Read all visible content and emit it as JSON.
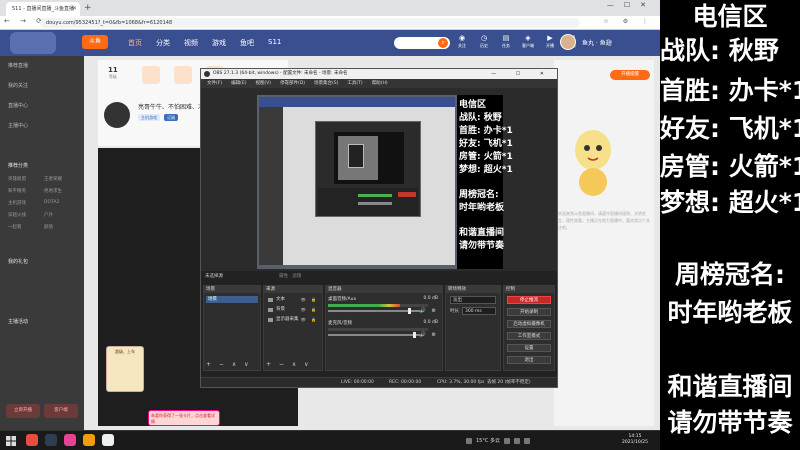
{
  "browser": {
    "tab_title": "511 - 直播间直播_斗鱼直播",
    "url": "douyu.com/9532451?_t=0&fb=1068&fr=6120148",
    "nav_buttons": "← → ⟳",
    "icons": "☆ ⚙ ⋮"
  },
  "site": {
    "logo": "斗鱼",
    "nav": [
      "首页",
      "分类",
      "视频",
      "游戏",
      "鱼吧",
      "S11"
    ],
    "search_icon": "search-icon",
    "header_icons": [
      {
        "glyph": "◉",
        "label": "关注"
      },
      {
        "glyph": "◷",
        "label": "历史"
      },
      {
        "glyph": "▤",
        "label": "任务"
      },
      {
        "glyph": "◈",
        "label": "客户端"
      },
      {
        "glyph": "▶",
        "label": "开播"
      },
      {
        "glyph": "✉",
        "label": "消息"
      }
    ],
    "header_right": "鱼丸 · 鱼翅"
  },
  "sidebar": {
    "items": [
      "推荐直播",
      "我的关注",
      "直播中心",
      "主播中心"
    ],
    "sections": [
      "推荐分类",
      "我的礼包",
      "主播活动"
    ],
    "sub_items": [
      "英雄联盟",
      "王者荣耀",
      "和平精英",
      "绝地求生",
      "主机游戏",
      "DOTA2",
      "穿越火线",
      "户外",
      "一起看",
      "颜值"
    ],
    "buttons": [
      "立即开播",
      "客户端"
    ]
  },
  "content": {
    "stat_value": "11",
    "stat_label": "等级",
    "room_title": "亮哥牛牛、不怕困难、冲冲冲",
    "room_tags": [
      "主机游戏",
      "订阅"
    ],
    "gift_label": "超级、上车",
    "toast_text": "恭喜你获得了一张卡片，点击查看详情",
    "right_tab": "开播提醒",
    "right_text": "欢迎来到斗鱼直播间，请遵守直播间规则，文明发言，理性观看。主播正在努力直播中，喜欢就点个关注吧。"
  },
  "obs": {
    "title": "OBS 27.1.3 (64-bit, windows) - 配置文件: 未命名 - 场景: 未命名",
    "window_controls": "— ☐ ✕",
    "menu": [
      "文件(F)",
      "编辑(E)",
      "视图(V)",
      "停靠部件(D)",
      "场景集合(S)",
      "工具(T)",
      "帮助(H)"
    ],
    "preview_text": [
      "电信区",
      "战队: 秋野",
      "首胜: 办卡*1",
      "好友: 飞机*1",
      "房管: 火箭*1",
      "梦想: 超火*1",
      "",
      "周榜冠名:",
      "时年哟老板",
      "",
      "和谐直播间",
      "请勿带节奏"
    ],
    "dock_status": "未选择源",
    "dock_props": "属性 · 滤镜",
    "docks": {
      "scenes": "场景",
      "sources": "来源",
      "mixer": "混音器",
      "transitions": "转场特效",
      "controls": "控制"
    },
    "scene_items": [
      "场景"
    ],
    "sources": [
      "文本",
      "背景",
      "显示器采集"
    ],
    "source_controls": "👁 🔒",
    "dock_footer": "+ − ∧ ∨",
    "mixer_channels": [
      {
        "name": "桌面音频/Aux",
        "db": "0.0 dB",
        "level": 0.72,
        "fader": 0.9
      },
      {
        "name": "麦克风/音频",
        "db": "0.0 dB",
        "level": 0.0,
        "fader": 0.95
      }
    ],
    "mixer_controls": "🔊 ⚙",
    "transition": {
      "type": "淡出",
      "duration_label": "时长",
      "duration": "300 ms"
    },
    "controls": [
      "停止推流",
      "开始录制",
      "启动虚拟摄像机",
      "工作室模式",
      "设置",
      "退出"
    ],
    "status": {
      "live": "LIVE: 00:00:00",
      "rec": "REC: 00:00:00",
      "cpu": "CPU: 3.7%, 30.00 fps",
      "drops": "丢帧 20 (帧率不稳定)"
    }
  },
  "taskbar": {
    "tray_text": "15°C 多云",
    "clock_time": "14:15",
    "clock_date": "2021/10/25",
    "apps": [
      "#e74c3c",
      "#2c3e50",
      "#e84393",
      "#f39c12",
      "#ecf0f1"
    ]
  },
  "overlay": {
    "lines": [
      "电信区",
      "战队:  秋野",
      "首胜: 办卡*1",
      "好友: 飞机*1",
      "房管: 火箭*1",
      "梦想: 超火*1"
    ],
    "weekly_title": "周榜冠名:",
    "weekly_name": "时年哟老板",
    "notice_1": "和谐直播间",
    "notice_2": "请勿带节奏"
  }
}
